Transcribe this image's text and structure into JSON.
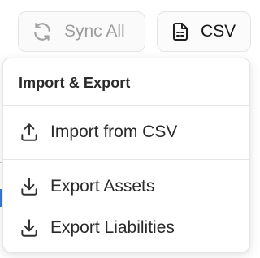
{
  "toolbar": {
    "sync_all_label": "Sync All",
    "sync_icon": "refresh-icon",
    "csv_label": "CSV",
    "csv_icon": "file-spreadsheet-icon"
  },
  "menu": {
    "title": "Import & Export",
    "items": [
      {
        "label": "Import from CSV",
        "icon": "upload-icon"
      },
      {
        "label": "Export Assets",
        "icon": "download-icon"
      },
      {
        "label": "Export Liabilities",
        "icon": "download-icon"
      }
    ]
  },
  "colors": {
    "text_primary": "#2a2a2a",
    "text_disabled": "#9c9c9c",
    "border": "#e4e4e4",
    "accent_behind": "#2f7be5"
  }
}
